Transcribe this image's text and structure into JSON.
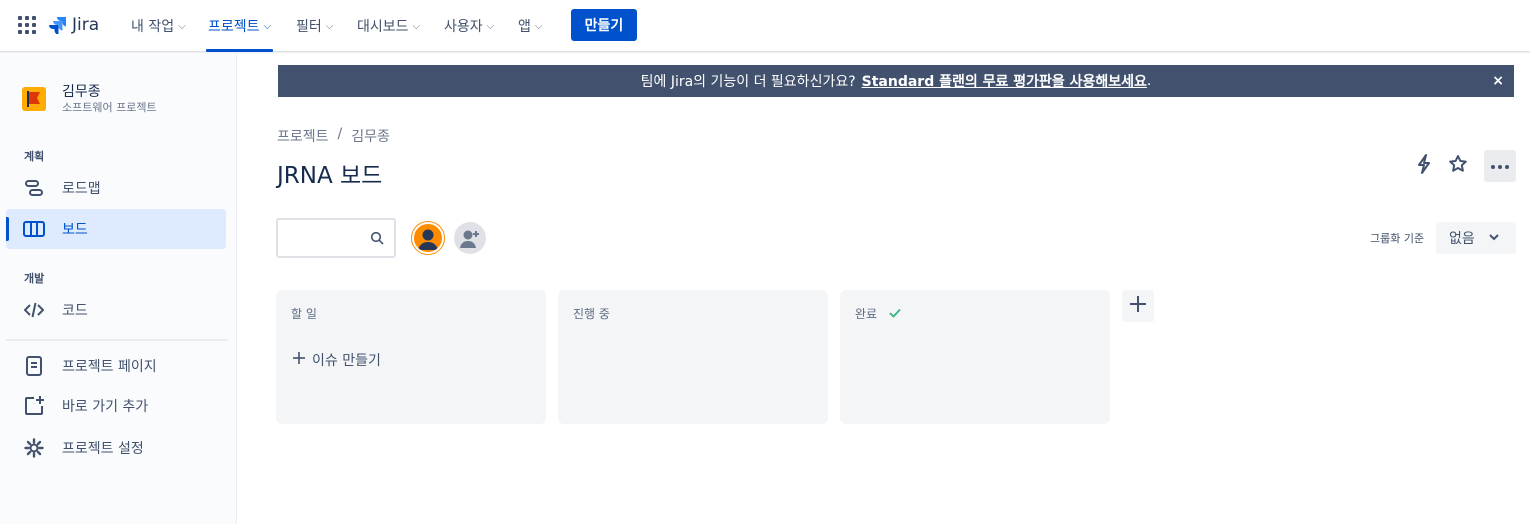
{
  "topnav": {
    "logo_text": "Jira",
    "items": [
      {
        "label": "내 작업"
      },
      {
        "label": "프로젝트"
      },
      {
        "label": "필터"
      },
      {
        "label": "대시보드"
      },
      {
        "label": "사용자"
      },
      {
        "label": "앱"
      }
    ],
    "create_label": "만들기"
  },
  "sidebar": {
    "project_name": "김무종",
    "project_type": "소프트웨어 프로젝트",
    "planning_label": "계획",
    "roadmap_label": "로드맵",
    "board_label": "보드",
    "dev_label": "개발",
    "code_label": "코드",
    "project_pages_label": "프로젝트 페이지",
    "add_shortcut_label": "바로 가기 추가",
    "project_settings_label": "프로젝트 설정"
  },
  "banner": {
    "text": "팀에 Jira의 기능이 더 필요하신가요?",
    "link": "Standard 플랜의 무료 평가판을 사용해보세요",
    "suffix": ".",
    "close": "×"
  },
  "breadcrumb": {
    "root": "프로젝트",
    "sep": "/",
    "current": "김무종"
  },
  "page_title": "JRNA 보드",
  "search": {
    "placeholder": ""
  },
  "group_by": {
    "label": "그룹화 기준",
    "value": "없음"
  },
  "columns": [
    {
      "title": "할 일"
    },
    {
      "title": "진행 중"
    },
    {
      "title": "완료"
    }
  ],
  "create_issue_label": "이슈 만들기",
  "colors": {
    "accent": "#0052cc",
    "banner": "#42526e",
    "done_check": "#36b37e"
  }
}
